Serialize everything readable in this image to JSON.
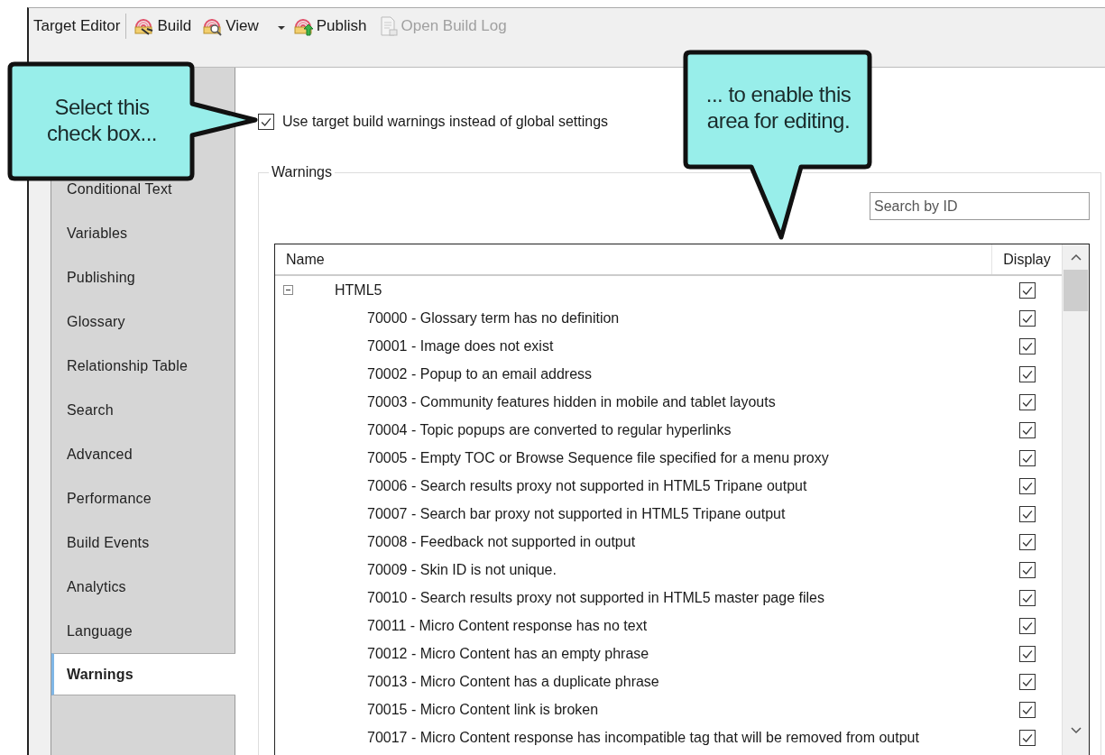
{
  "toolbar": {
    "title": "Target Editor",
    "buttons": [
      {
        "label": "Build",
        "kind": "build",
        "disabled": false,
        "dropdown": false
      },
      {
        "label": "View",
        "kind": "view",
        "disabled": false,
        "dropdown": true
      },
      {
        "label": "Publish",
        "kind": "publish",
        "disabled": false,
        "dropdown": false
      },
      {
        "label": "Open Build Log",
        "kind": "log",
        "disabled": true,
        "dropdown": false
      }
    ]
  },
  "sidebar": {
    "items": [
      {
        "label": "Conditional Text",
        "selected": false
      },
      {
        "label": "Variables",
        "selected": false
      },
      {
        "label": "Publishing",
        "selected": false
      },
      {
        "label": "Glossary",
        "selected": false
      },
      {
        "label": "Relationship Table",
        "selected": false
      },
      {
        "label": "Search",
        "selected": false
      },
      {
        "label": "Advanced",
        "selected": false
      },
      {
        "label": "Performance",
        "selected": false
      },
      {
        "label": "Build Events",
        "selected": false
      },
      {
        "label": "Analytics",
        "selected": false
      },
      {
        "label": "Language",
        "selected": false
      },
      {
        "label": "Warnings",
        "selected": true
      }
    ]
  },
  "option": {
    "label": "Use target build warnings instead of global settings",
    "checked": true
  },
  "warnings_group": {
    "title": "Warnings",
    "search": {
      "placeholder": "Search by ID"
    },
    "table": {
      "columns": [
        "Name",
        "Display"
      ],
      "rows": [
        {
          "label": "HTML5",
          "expanded": true,
          "checked": true,
          "children": [
            {
              "label": "70000 - Glossary term has no definition",
              "checked": true
            },
            {
              "label": "70001 - Image does not exist",
              "checked": true
            },
            {
              "label": "70002 - Popup to an email address",
              "checked": true
            },
            {
              "label": "70003 - Community features hidden in mobile and tablet layouts",
              "checked": true
            },
            {
              "label": "70004 - Topic popups are converted to regular hyperlinks",
              "checked": true
            },
            {
              "label": "70005 - Empty TOC or Browse Sequence file specified for a menu proxy",
              "checked": true
            },
            {
              "label": "70006 - Search results proxy not supported in HTML5 Tripane output",
              "checked": true
            },
            {
              "label": "70007 - Search bar proxy not supported in HTML5 Tripane output",
              "checked": true
            },
            {
              "label": "70008 - Feedback not supported in output",
              "checked": true
            },
            {
              "label": "70009 - Skin ID is not unique.",
              "checked": true
            },
            {
              "label": "70010 - Search results proxy not supported in HTML5 master page files",
              "checked": true
            },
            {
              "label": "70011 - Micro Content response has no text",
              "checked": true
            },
            {
              "label": "70012 - Micro Content has an empty phrase",
              "checked": true
            },
            {
              "label": "70013 - Micro Content has a duplicate phrase",
              "checked": true
            },
            {
              "label": "70015 - Micro Content link is broken",
              "checked": true
            },
            {
              "label": "70017 - Micro Content response has incompatible tag that will be removed from output",
              "checked": true
            }
          ]
        }
      ]
    }
  },
  "callouts": [
    {
      "kind": "right",
      "text": "Select this check box..."
    },
    {
      "kind": "down",
      "text": "... to enable this area for editing."
    }
  ]
}
